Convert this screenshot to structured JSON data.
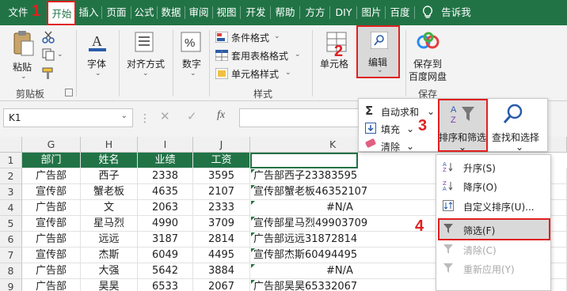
{
  "tabs": [
    "文件",
    "开始",
    "插入",
    "页面",
    "公式",
    "数据",
    "审阅",
    "视图",
    "开发",
    "帮助",
    "方方",
    "DIY",
    "图片",
    "百度",
    "告诉我"
  ],
  "step_numbers": [
    "1",
    "2",
    "3",
    "4"
  ],
  "ribbon": {
    "clipboard": {
      "paste": "粘贴",
      "group": "剪贴板"
    },
    "font": {
      "label": "字体"
    },
    "align": {
      "label": "对齐方式"
    },
    "number": {
      "label": "数字"
    },
    "styles": {
      "items": [
        "条件格式",
        "套用表格格式",
        "单元格样式"
      ],
      "group": "样式"
    },
    "cells": {
      "label": "单元格"
    },
    "edit": {
      "label": "编辑"
    },
    "baidu": {
      "label_line1": "保存到",
      "label_line2": "百度网盘",
      "group": "保存"
    }
  },
  "name_box": {
    "value": "K1"
  },
  "fx_label": "fx",
  "grid": {
    "col_headers": [
      "G",
      "H",
      "I",
      "J",
      "K"
    ],
    "row_headers": [
      "1",
      "2",
      "3",
      "4",
      "5",
      "6",
      "7",
      "8",
      "9"
    ],
    "header_row": [
      "部门",
      "姓名",
      "业绩",
      "工资"
    ],
    "rows": [
      [
        "广告部",
        "西子",
        "2338",
        "3595",
        "广告部西子23383595"
      ],
      [
        "宣传部",
        "蟹老板",
        "4635",
        "2107",
        "宣传部蟹老板46352107"
      ],
      [
        "广告部",
        "文",
        "2063",
        "2333",
        "#N/A"
      ],
      [
        "宣传部",
        "星马烈",
        "4990",
        "3709",
        "宣传部星马烈49903709"
      ],
      [
        "广告部",
        "远远",
        "3187",
        "2814",
        "广告部远远31872814"
      ],
      [
        "宣传部",
        "杰斯",
        "6049",
        "4495",
        "宣传部杰斯60494495"
      ],
      [
        "广告部",
        "大强",
        "5642",
        "3884",
        "#N/A"
      ],
      [
        "广告部",
        "昊昊",
        "6533",
        "2067",
        "广告部昊昊65332067"
      ]
    ]
  },
  "edit_menu": {
    "items": [
      "自动求和",
      "填充",
      "清除"
    ],
    "sort_filter": "排序和筛选",
    "find_select": "查找和选择"
  },
  "sort_menu": {
    "items": [
      {
        "label": "升序(S)",
        "disabled": false
      },
      {
        "label": "降序(O)",
        "disabled": false
      },
      {
        "label": "自定义排序(U)...",
        "disabled": false
      },
      {
        "label": "筛选(F)",
        "disabled": false
      },
      {
        "label": "清除(C)",
        "disabled": true
      },
      {
        "label": "重新应用(Y)",
        "disabled": true
      }
    ]
  },
  "colors": {
    "excel_green": "#217346",
    "highlight_red": "#e02020",
    "hover_gray": "#d9d9d9"
  }
}
